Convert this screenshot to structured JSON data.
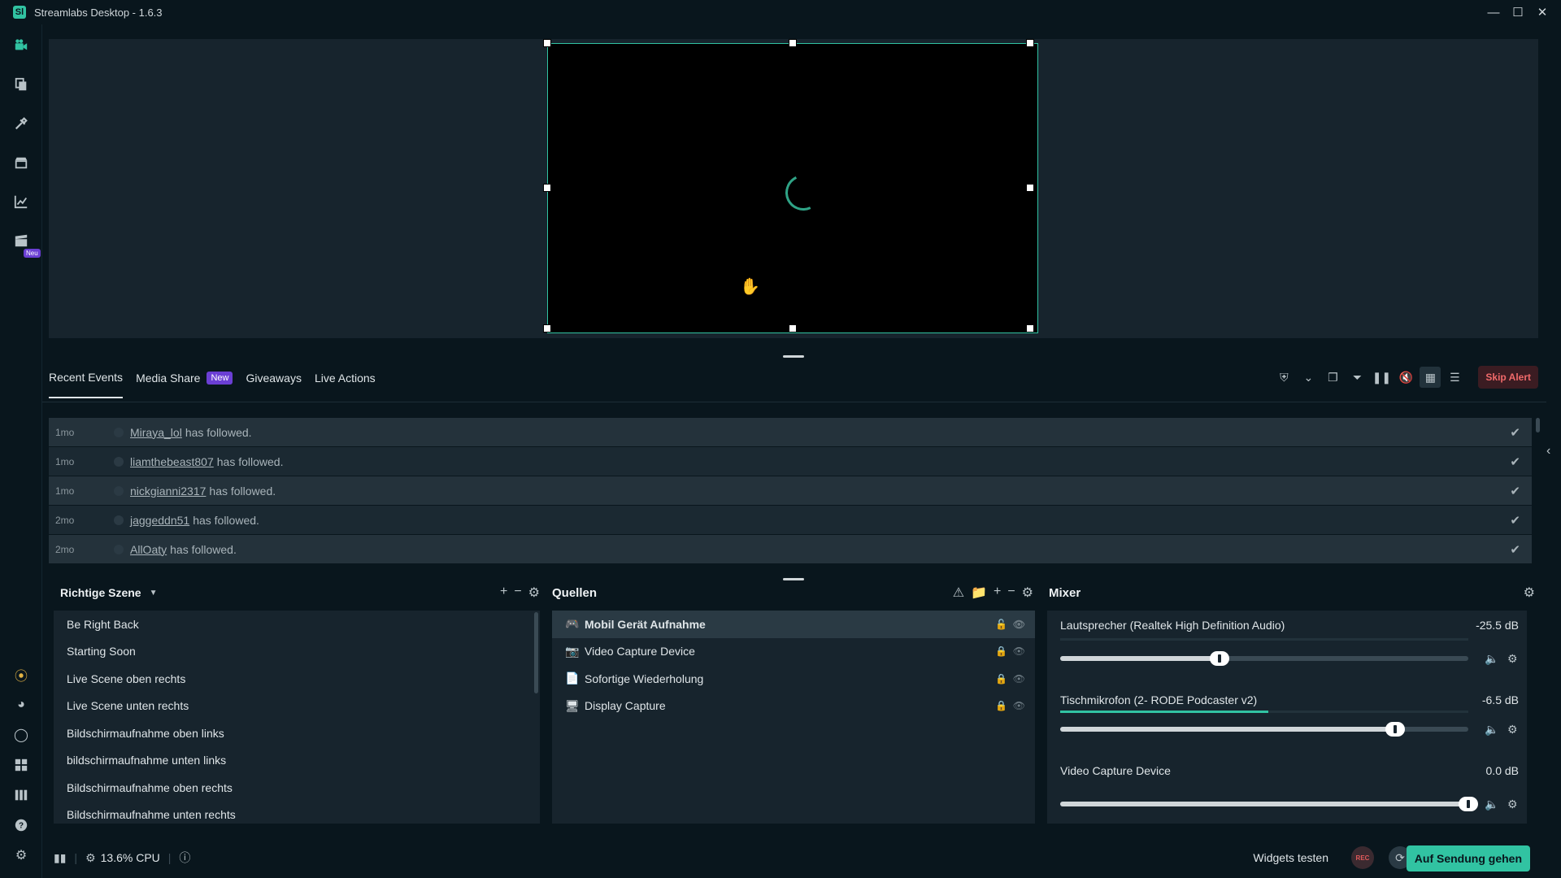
{
  "window": {
    "title": "Streamlabs Desktop - 1.6.3",
    "logo": "Sl"
  },
  "sidebar": {
    "new_badge": "Neu"
  },
  "events": {
    "tabs": [
      {
        "label": "Recent Events"
      },
      {
        "label": "Media Share"
      },
      {
        "label": "Giveaways"
      },
      {
        "label": "Live Actions"
      }
    ],
    "new_badge": "New",
    "skip_alert": "Skip Alert",
    "rows": [
      {
        "time": "1mo",
        "user": "Miraya_lol",
        "action": "has followed."
      },
      {
        "time": "1mo",
        "user": "liamthebeast807",
        "action": "has followed."
      },
      {
        "time": "1mo",
        "user": "nickgianni2317",
        "action": "has followed."
      },
      {
        "time": "2mo",
        "user": "jaggeddn51",
        "action": "has followed."
      },
      {
        "time": "2mo",
        "user": "AllOaty",
        "action": "has followed."
      }
    ]
  },
  "scenes": {
    "title": "Richtige Szene",
    "items": [
      "Be Right Back",
      "Starting Soon",
      "Live Scene oben rechts",
      "Live Scene unten rechts",
      "Bildschirmaufnahme oben links",
      "bildschirmaufnahme unten links",
      "Bildschirmaufnahme oben rechts",
      "Bildschirmaufnahme unten rechts"
    ]
  },
  "sources": {
    "title": "Quellen",
    "items": [
      {
        "label": "Mobil Gerät Aufnahme",
        "icon": "gamepad-icon"
      },
      {
        "label": "Video Capture Device",
        "icon": "webcam-icon"
      },
      {
        "label": "Sofortige Wiederholung",
        "icon": "file-icon"
      },
      {
        "label": "Display Capture",
        "icon": "monitor-icon"
      }
    ]
  },
  "mixer": {
    "title": "Mixer",
    "channels": [
      {
        "name": "Lautsprecher (Realtek High Definition Audio)",
        "db": "-25.5 dB",
        "level": 0.39,
        "meter": 0.0
      },
      {
        "name": "Tischmikrofon (2- RODE Podcaster v2)",
        "db": "-6.5 dB",
        "level": 0.82,
        "meter": 0.51
      },
      {
        "name": "Video Capture Device",
        "db": "0.0 dB",
        "level": 1.0,
        "meter": 0.0
      }
    ]
  },
  "footer": {
    "cpu": "13.6% CPU",
    "widgets_test": "Widgets testen",
    "rec_label": "REC",
    "go_live": "Auf Sendung gehen"
  },
  "colors": {
    "accent": "#31c3a2",
    "badge": "#6b3fd4",
    "danger": "#f06a6a"
  }
}
